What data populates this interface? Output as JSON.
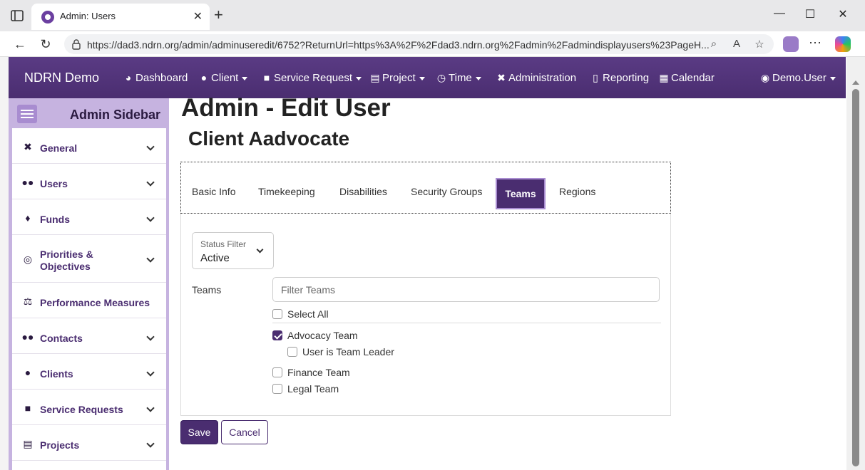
{
  "browser": {
    "tab_title": "Admin: Users",
    "url": "https://dad3.ndrn.org/admin/adminuseredit/6752?ReturnUrl=https%3A%2F%2Fdad3.ndrn.org%2Fadmin%2Fadmindisplayusers%23PageH..."
  },
  "navbar": {
    "brand": "NDRN Demo",
    "items": [
      {
        "label": "Dashboard",
        "icon": "dashboard-icon",
        "dropdown": false
      },
      {
        "label": "Client",
        "icon": "user-icon",
        "dropdown": true
      },
      {
        "label": "Service Request",
        "icon": "briefcase-icon",
        "dropdown": true
      },
      {
        "label": "Project",
        "icon": "clipboard-icon",
        "dropdown": true
      },
      {
        "label": "Time",
        "icon": "clock-icon",
        "dropdown": true
      },
      {
        "label": "Administration",
        "icon": "tools-icon",
        "dropdown": false
      },
      {
        "label": "Reporting",
        "icon": "file-icon",
        "dropdown": false
      },
      {
        "label": "Calendar",
        "icon": "calendar-icon",
        "dropdown": false
      }
    ],
    "user": "Demo.User"
  },
  "sidebar": {
    "title": "Admin Sidebar",
    "items": [
      {
        "label": "General",
        "icon": "tools-icon"
      },
      {
        "label": "Users",
        "icon": "users-icon"
      },
      {
        "label": "Funds",
        "icon": "money-bag-icon"
      },
      {
        "label": "Priorities & Objectives",
        "icon": "target-icon"
      },
      {
        "label": "Performance Measures",
        "icon": "scale-icon"
      },
      {
        "label": "Contacts",
        "icon": "contacts-icon"
      },
      {
        "label": "Clients",
        "icon": "user-icon"
      },
      {
        "label": "Service Requests",
        "icon": "briefcase-icon"
      },
      {
        "label": "Projects",
        "icon": "clipboard-icon"
      }
    ]
  },
  "main": {
    "title": "Admin - Edit User",
    "subtitle": "Client Aadvocate",
    "tabs": [
      "Basic Info",
      "Timekeeping",
      "Disabilities",
      "Security Groups",
      "Teams",
      "Regions"
    ],
    "active_tab": "Teams",
    "status_filter": {
      "label": "Status Filter",
      "value": "Active"
    },
    "teams_label": "Teams",
    "filter_placeholder": "Filter Teams",
    "select_all": "Select All",
    "teams": [
      {
        "name": "Advocacy Team",
        "checked": true,
        "leader_label": "User is Team Leader",
        "leader_checked": false
      },
      {
        "name": "Finance Team",
        "checked": false
      },
      {
        "name": "Legal Team",
        "checked": false
      }
    ],
    "save_label": "Save",
    "cancel_label": "Cancel"
  },
  "colors": {
    "primary": "#4a2d70",
    "sidebar": "#c6b3e0"
  }
}
